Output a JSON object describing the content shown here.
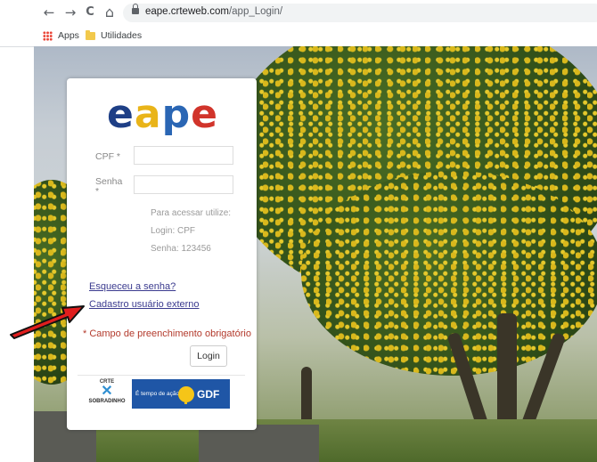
{
  "browser": {
    "nav": {
      "back": "←",
      "forward": "→",
      "reload": "C",
      "home": "⌂"
    },
    "url_host": "eape.crteweb.com",
    "url_path": "/app_Login/",
    "bookmarks": [
      {
        "label": "Apps",
        "icon": "apps-grid-icon"
      },
      {
        "label": "Utilidades",
        "icon": "folder-icon"
      }
    ]
  },
  "login": {
    "logo": {
      "letters": [
        "e",
        "a",
        "p",
        "e"
      ],
      "colors": [
        "#1e3f86",
        "#e9b419",
        "#2a66b4",
        "#d1342b"
      ]
    },
    "cpf_label": "CPF *",
    "senha_label": "Senha",
    "senha_asterisk": "*",
    "cpf_value": "",
    "senha_value": "",
    "hint_title": "Para acessar utilize:",
    "hint_login": "Login: CPF",
    "hint_senha": "Senha: 123456",
    "forgot_link": "Esqueceu a senha?",
    "register_link": "Cadastro usuário externo",
    "required_note": "* Campo de preenchimento obrigatório",
    "login_button": "Login"
  },
  "footer_logos": {
    "crte_top": "CRTE",
    "crte_bottom": "SOBRADINHO",
    "gdf_slogan": "É tempo de ação.",
    "gdf_word": "GDF"
  },
  "colors": {
    "required": "#b33a2c",
    "link": "#3b3b8f",
    "arrow": "#e01e1e",
    "gdf_blue": "#1f56a6"
  }
}
